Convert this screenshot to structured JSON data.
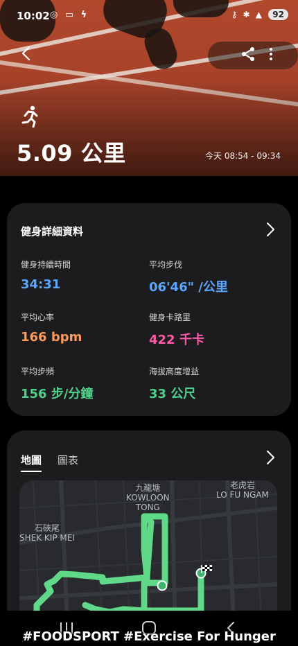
{
  "status_bar": {
    "time": "10:02",
    "notifications": "◎ ▭ ϟ",
    "system_icons": "⚷ ✱ ▲",
    "battery": "92"
  },
  "header": {
    "distance": "5.09 公里",
    "time_range": "今天 08:54 - 09:34"
  },
  "details": {
    "title": "健身詳細資料",
    "metrics": [
      {
        "label": "健身持續時間",
        "value": "34:31",
        "color": "#5aa7ff"
      },
      {
        "label": "平均步伐",
        "value": "06'46\" /公里",
        "color": "#5aa7ff"
      },
      {
        "label": "平均心率",
        "value": "166 bpm",
        "color": "#ff9a5c"
      },
      {
        "label": "健身卡路里",
        "value": "422 千卡",
        "color": "#ff5aa8"
      },
      {
        "label": "平均步頻",
        "value": "156 步/分鐘",
        "color": "#4fd08b"
      },
      {
        "label": "海拔高度增益",
        "value": "33 公尺",
        "color": "#4fd08b"
      }
    ]
  },
  "map_card": {
    "tabs": [
      "地圖",
      "圖表"
    ],
    "places": [
      {
        "text": "九龍塘\nKOWLOON\nTONG"
      },
      {
        "text": "老虎岩\nLO FU NGAM"
      },
      {
        "text": "石硤尾\nSHEK KIP MEI"
      }
    ]
  },
  "caption": "#FOODSPORT  #Exercise  For Hunger",
  "colors": {
    "route": "#5fd987",
    "card": "#1c1c1e"
  }
}
